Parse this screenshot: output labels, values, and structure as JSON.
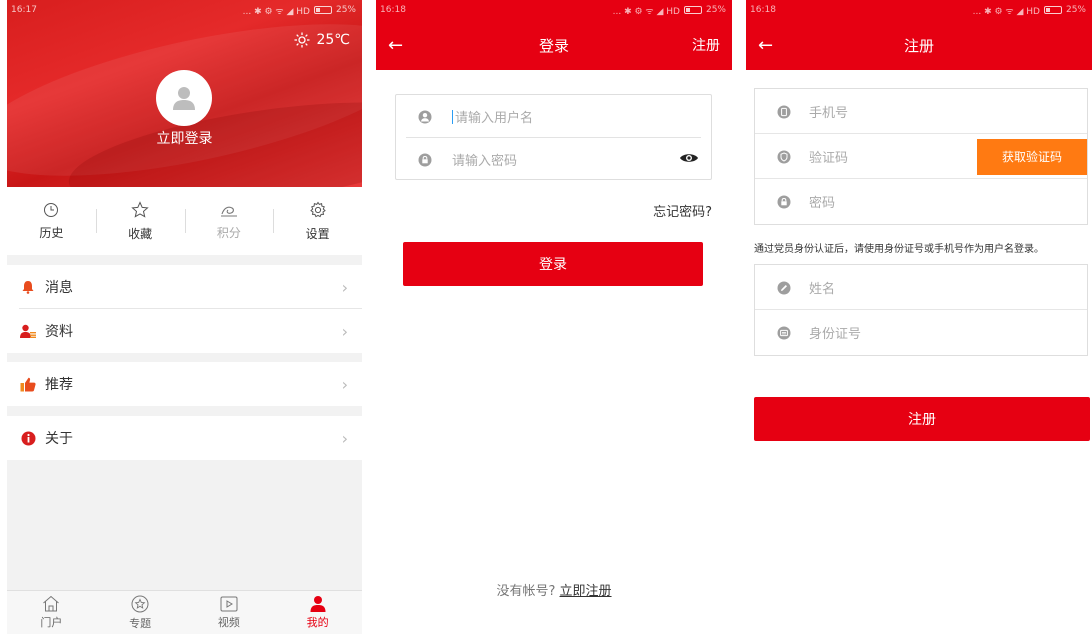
{
  "screens": {
    "profile": {
      "status_time": "16:17",
      "status_right": "... ✱ ⚙ ᯤ ◢ HD",
      "battery": "25%",
      "weather": {
        "icon": "sun-icon",
        "temp": "25℃"
      },
      "login_label": "立即登录",
      "quick_actions": [
        {
          "label": "历史",
          "icon": "clock-icon"
        },
        {
          "label": "收藏",
          "icon": "star-icon"
        },
        {
          "label": "积分",
          "icon": "points-icon"
        },
        {
          "label": "设置",
          "icon": "gear-icon"
        }
      ],
      "menu": [
        {
          "label": "消息",
          "icon": "bell-icon"
        },
        {
          "label": "资料",
          "icon": "profile-card-icon"
        },
        {
          "label": "推荐",
          "icon": "thumbs-up-icon"
        },
        {
          "label": "关于",
          "icon": "info-icon"
        }
      ],
      "tabs": [
        {
          "label": "门户",
          "icon": "home-icon"
        },
        {
          "label": "专题",
          "icon": "topic-star-icon"
        },
        {
          "label": "视频",
          "icon": "play-icon"
        },
        {
          "label": "我的",
          "icon": "user-icon"
        }
      ]
    },
    "login": {
      "status_time": "16:18",
      "status_right": "... ✱ ⚙ ᯤ ◢ HD",
      "battery": "25%",
      "title": "登录",
      "right_action": "注册",
      "username_placeholder": "请输入用户名",
      "password_placeholder": "请输入密码",
      "forgot": "忘记密码?",
      "login_button": "登录",
      "no_account": "没有帐号?",
      "register_link": "立即注册"
    },
    "register": {
      "status_time": "16:18",
      "status_right": "... ✱ ⚙ ᯤ ◢ HD",
      "battery": "25%",
      "title": "注册",
      "phone_placeholder": "手机号",
      "code_placeholder": "验证码",
      "get_code_button": "获取验证码",
      "password_placeholder": "密码",
      "note": "通过党员身份认证后，请使用身份证号或手机号作为用户名登录。",
      "name_placeholder": "姓名",
      "id_placeholder": "身份证号",
      "register_button": "注册"
    }
  },
  "colors": {
    "brand_red": "#e60012",
    "orange": "#ff7a12"
  }
}
